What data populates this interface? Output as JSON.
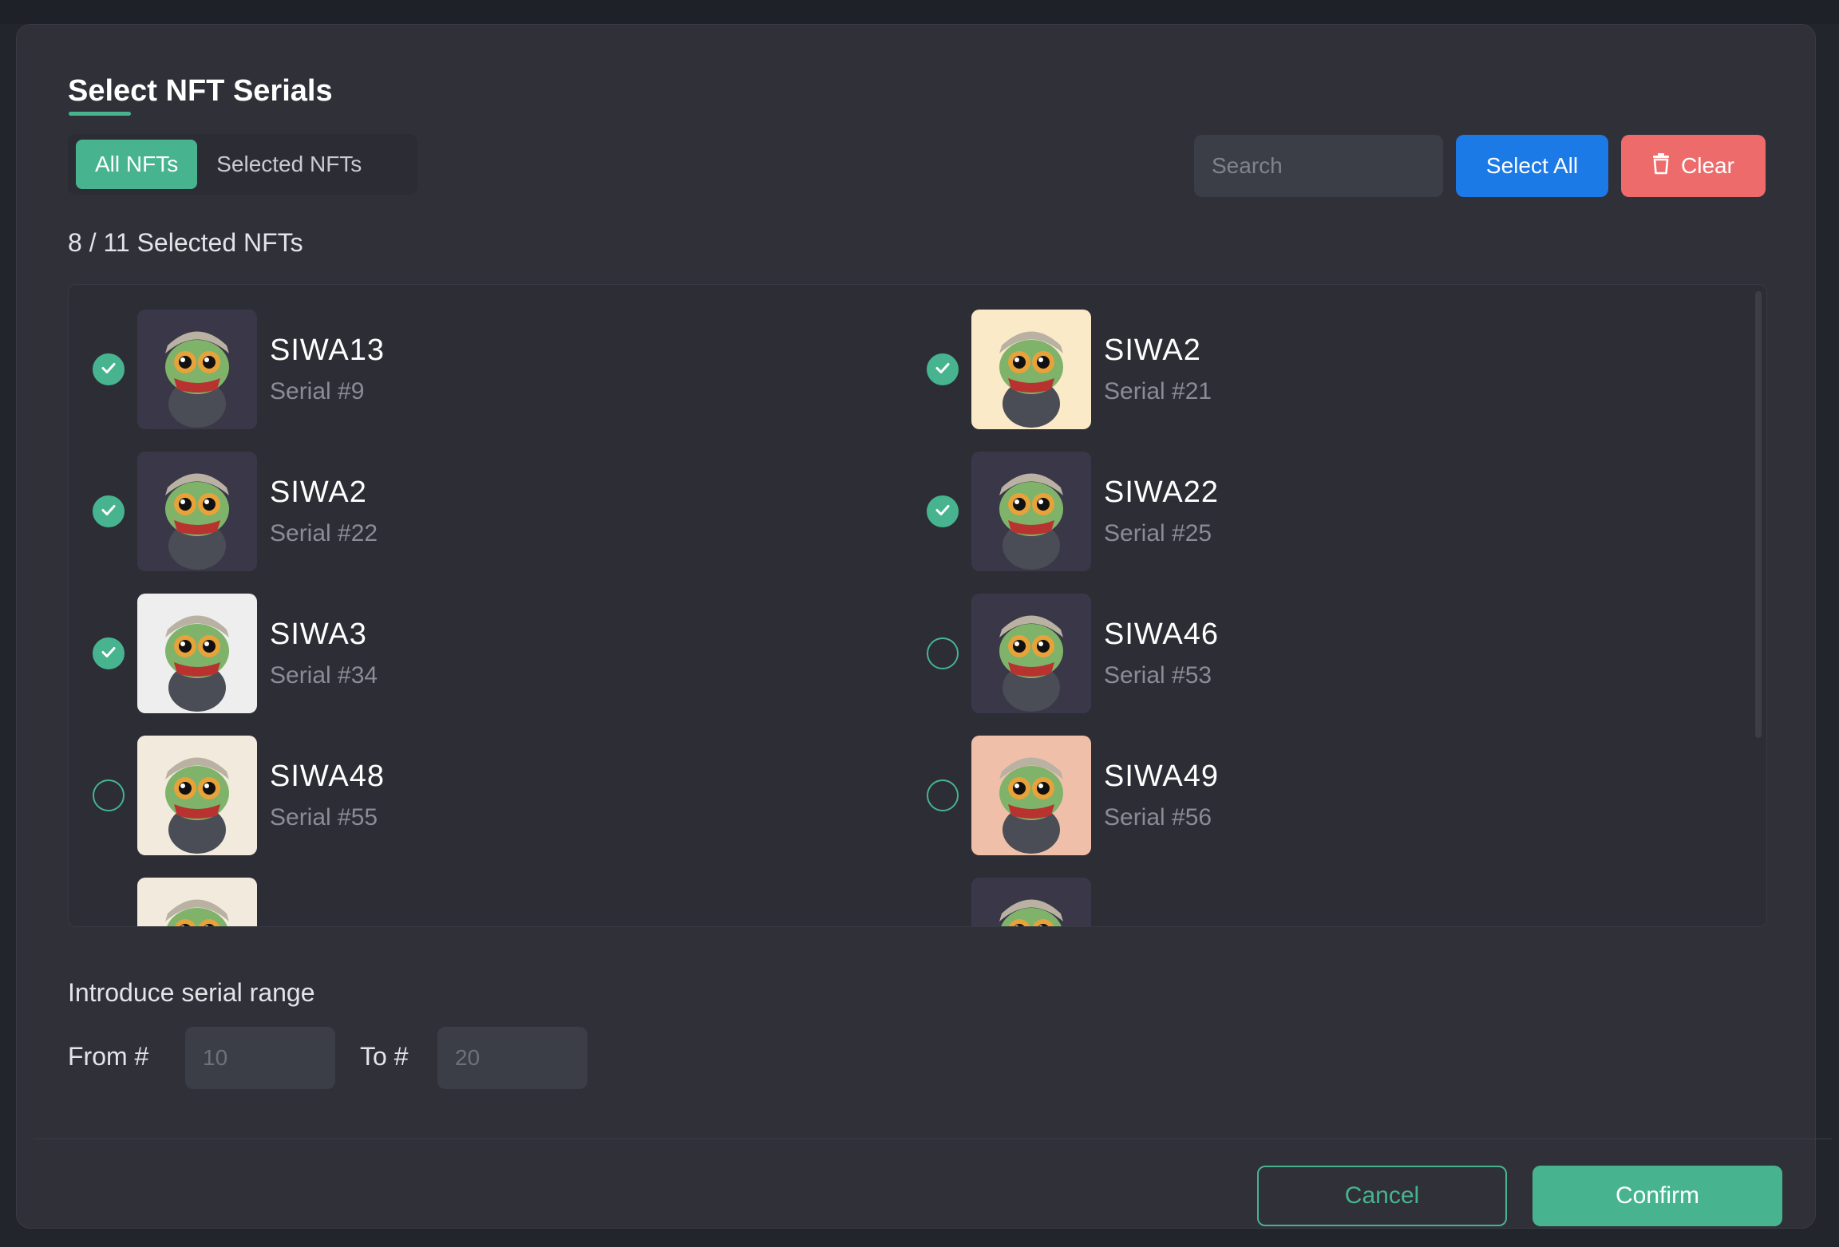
{
  "modal": {
    "title": "Select NFT Serials",
    "tabs": [
      {
        "label": "All NFTs",
        "active": true
      },
      {
        "label": "Selected NFTs",
        "active": false
      }
    ],
    "search_placeholder": "Search",
    "select_all_label": "Select All",
    "clear_label": "Clear",
    "selected_count": "8 / 11 Selected NFTs",
    "items": [
      {
        "name": "SIWA13",
        "serial": "Serial #9",
        "selected": true,
        "bg": "#3a3848"
      },
      {
        "name": "SIWA2",
        "serial": "Serial #21",
        "selected": true,
        "bg": "#fbeac8"
      },
      {
        "name": "SIWA2",
        "serial": "Serial #22",
        "selected": true,
        "bg": "#3a3848"
      },
      {
        "name": "SIWA22",
        "serial": "Serial #25",
        "selected": true,
        "bg": "#3a3848"
      },
      {
        "name": "SIWA3",
        "serial": "Serial #34",
        "selected": true,
        "bg": "#eeeeee"
      },
      {
        "name": "SIWA46",
        "serial": "Serial #53",
        "selected": false,
        "bg": "#3a3848"
      },
      {
        "name": "SIWA48",
        "serial": "Serial #55",
        "selected": false,
        "bg": "#f2ebdd"
      },
      {
        "name": "SIWA49",
        "serial": "Serial #56",
        "selected": false,
        "bg": "#efbfaa"
      }
    ],
    "partial_items": [
      {
        "bg": "#f2ebdd"
      },
      {
        "bg": "#3a3848"
      }
    ],
    "range": {
      "label": "Introduce serial range",
      "from_label": "From #",
      "from_placeholder": "10",
      "to_label": "To #",
      "to_placeholder": "20"
    },
    "cancel_label": "Cancel",
    "confirm_label": "Confirm"
  },
  "colors": {
    "accent": "#47b48f",
    "primary_blue": "#1c7ae6",
    "danger": "#ed6b6b"
  },
  "icons": {
    "clear": "trash-icon",
    "check": "check-icon"
  }
}
